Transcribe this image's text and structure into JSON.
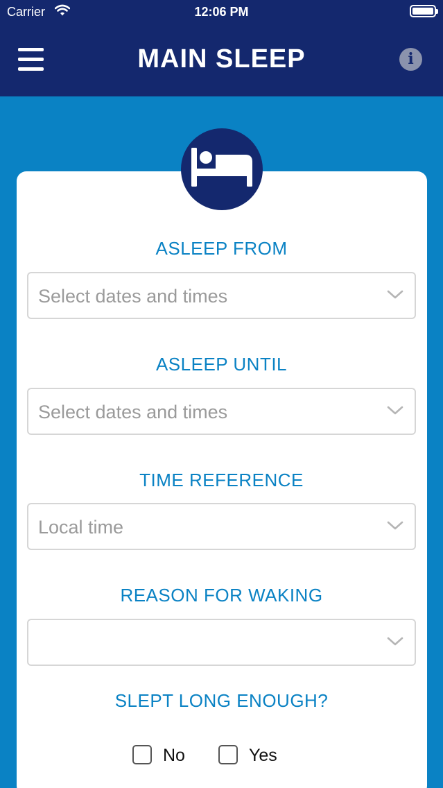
{
  "status_bar": {
    "carrier": "Carrier",
    "time": "12:06 PM"
  },
  "header": {
    "title": "MAIN SLEEP"
  },
  "form": {
    "asleep_from": {
      "label": "ASLEEP FROM",
      "value": "Select dates and times"
    },
    "asleep_until": {
      "label": "ASLEEP UNTIL",
      "value": "Select dates and times"
    },
    "time_reference": {
      "label": "TIME REFERENCE",
      "value": "Local time"
    },
    "reason_for_waking": {
      "label": "REASON FOR WAKING",
      "value": ""
    },
    "slept_long_enough": {
      "label": "SLEPT LONG ENOUGH?",
      "options": [
        "No",
        "Yes"
      ]
    }
  },
  "colors": {
    "header_bg": "#14286e",
    "page_bg": "#0a82c4",
    "label": "#0a82c4"
  },
  "icons": {
    "menu": "hamburger-menu-icon",
    "info": "info-icon",
    "bed": "bed-icon",
    "chevron": "chevron-down-icon"
  }
}
